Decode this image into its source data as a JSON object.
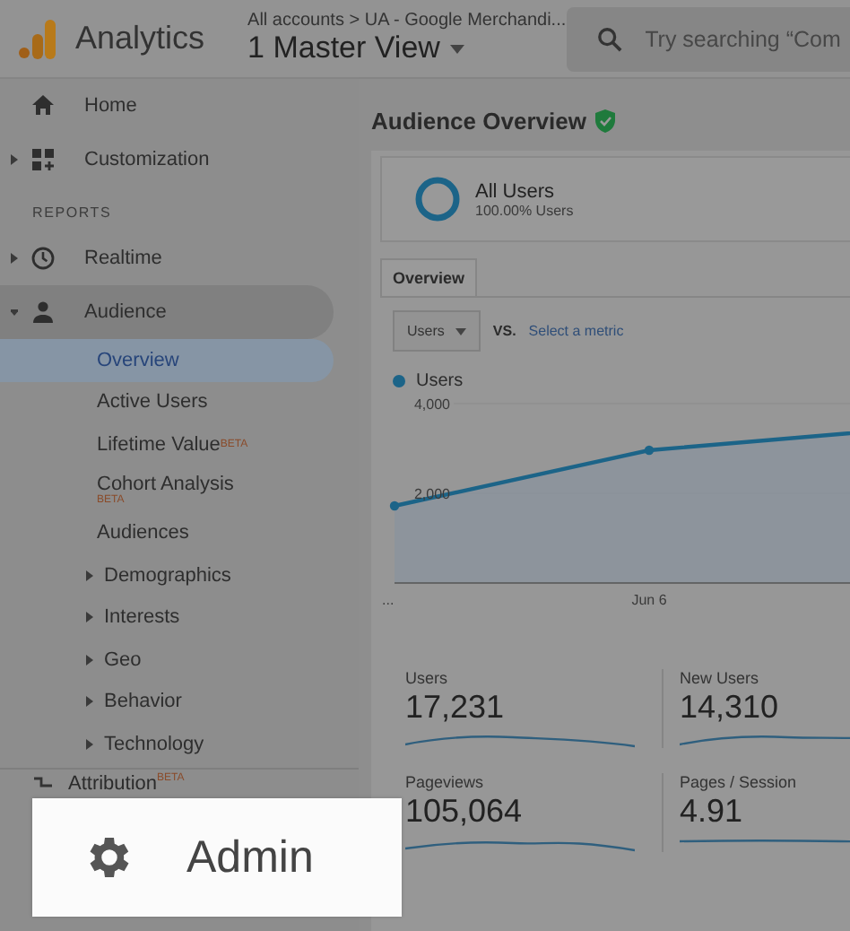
{
  "header": {
    "product": "Analytics",
    "breadcrumb": "All accounts > UA - Google Merchandi...",
    "view": "1 Master View",
    "search": {
      "placeholder": "Try searching “Com"
    }
  },
  "sidebar": {
    "top_items": [
      {
        "label": "Home",
        "kind": "link"
      },
      {
        "label": "Customization",
        "kind": "group"
      }
    ],
    "section": "REPORTS",
    "reports": [
      {
        "label": "Realtime",
        "expanded": false,
        "selected": false
      },
      {
        "label": "Audience",
        "expanded": true,
        "selected": true,
        "children": [
          {
            "label": "Overview",
            "selected": true,
            "kind": "link"
          },
          {
            "label": "Active Users",
            "selected": false,
            "kind": "link"
          },
          {
            "label": "Lifetime Value",
            "selected": false,
            "kind": "badge-inline",
            "badge": "BETA"
          },
          {
            "label": "Cohort Analysis",
            "selected": false,
            "kind": "badge-below",
            "badge": "BETA"
          },
          {
            "label": "Audiences",
            "selected": false,
            "kind": "link"
          },
          {
            "label": "Demographics",
            "selected": false,
            "kind": "group"
          },
          {
            "label": "Interests",
            "selected": false,
            "kind": "group"
          },
          {
            "label": "Geo",
            "selected": false,
            "kind": "group"
          },
          {
            "label": "Behavior",
            "selected": false,
            "kind": "group"
          },
          {
            "label": "Technology",
            "selected": false,
            "kind": "group"
          }
        ]
      }
    ],
    "footer_item": {
      "label": "Attribution",
      "badge": "BETA"
    },
    "admin": {
      "label": "Admin"
    }
  },
  "main": {
    "title": "Audience Overview",
    "segment": {
      "name": "All Users",
      "detail": "100.00% Users"
    },
    "tabs": [
      {
        "label": "Overview",
        "selected": true
      }
    ],
    "metric_select": {
      "value": "Users"
    },
    "vs": "VS.",
    "compare_link": "Select a metric",
    "chart_data": {
      "type": "area",
      "categories": [
        "...",
        "Jun 6",
        null
      ],
      "ylim": [
        0,
        4000
      ],
      "series": [
        {
          "name": "Users",
          "color": "#1c6488",
          "values": [
            1720,
            2960,
            3440
          ]
        }
      ],
      "yticks": [
        {
          "value": 2000,
          "label": "2,000"
        },
        {
          "value": 4000,
          "label": "4,000"
        }
      ]
    },
    "metrics": [
      {
        "label": "Users",
        "value": "17,231"
      },
      {
        "label": "New Users",
        "value": "14,310"
      },
      {
        "label": "Pageviews",
        "value": "105,064"
      },
      {
        "label": "Pages / Session",
        "value": "4.91"
      }
    ]
  }
}
